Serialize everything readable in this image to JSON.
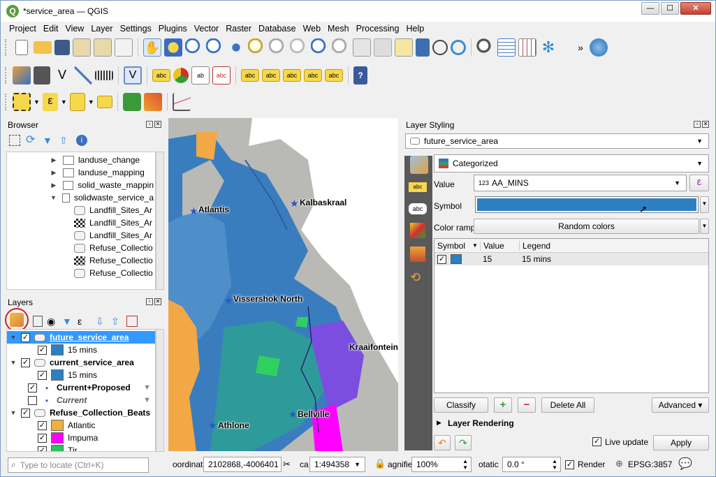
{
  "window": {
    "title": "*service_area — QGIS",
    "minimize": "—",
    "maximize": "☐",
    "close": "✕"
  },
  "menu": [
    "Project",
    "Edit",
    "View",
    "Layer",
    "Settings",
    "Plugins",
    "Vector",
    "Raster",
    "Database",
    "Web",
    "Mesh",
    "Processing",
    "Help"
  ],
  "browser": {
    "title": "Browser",
    "items": [
      {
        "label": "landuse_change",
        "type": "folder",
        "indent": 1,
        "arrow": "▶"
      },
      {
        "label": "landuse_mapping",
        "type": "folder",
        "indent": 1,
        "arrow": "▶"
      },
      {
        "label": "solid_waste_mappin",
        "type": "folder",
        "indent": 1,
        "arrow": "▶"
      },
      {
        "label": "solidwaste_service_a",
        "type": "folder",
        "indent": 1,
        "arrow": "▼"
      },
      {
        "label": "Landfill_Sites_Ar",
        "type": "polygon",
        "indent": 2
      },
      {
        "label": "Landfill_Sites_Ar",
        "type": "raster",
        "indent": 2
      },
      {
        "label": "Landfill_Sites_Ar",
        "type": "polygon",
        "indent": 2
      },
      {
        "label": "Refuse_Collectio",
        "type": "polygon",
        "indent": 2
      },
      {
        "label": "Refuse_Collectio",
        "type": "raster",
        "indent": 2
      },
      {
        "label": "Refuse_Collectio",
        "type": "polygon",
        "indent": 2
      }
    ]
  },
  "layers": {
    "title": "Layers",
    "items": [
      {
        "label": "future_service_area",
        "kind": "layer",
        "checked": true,
        "selected": true,
        "arrow": "▼"
      },
      {
        "label": "15 mins",
        "kind": "class",
        "checked": true,
        "color": "#2e7fc2"
      },
      {
        "label": "current_service_area",
        "kind": "layer",
        "checked": true,
        "arrow": "▼"
      },
      {
        "label": "15 mins",
        "kind": "class",
        "checked": true,
        "color": "#2e7fc2"
      },
      {
        "label": "Current+Proposed",
        "kind": "point",
        "checked": true
      },
      {
        "label": "Current",
        "kind": "point-italic",
        "checked": false
      },
      {
        "label": "Refuse_Collection_Beats",
        "kind": "layer",
        "checked": true,
        "arrow": "▼"
      },
      {
        "label": "Atlantic",
        "kind": "class",
        "checked": true,
        "color": "#f0b040"
      },
      {
        "label": "Impuma",
        "kind": "class",
        "checked": true,
        "color": "#ff00ff"
      },
      {
        "label": "Tir...",
        "kind": "class",
        "checked": true,
        "color": "#30c060"
      }
    ]
  },
  "map_labels": [
    "Atlantis",
    "Kalbaskraal",
    "Vissershok North",
    "Kraaifontein",
    "Bellville",
    "Athlone"
  ],
  "styling": {
    "title": "Layer Styling",
    "layer": "future_service_area",
    "renderer": "Categorized",
    "value_label": "Value",
    "value_prefix": "123",
    "value": "AA_MINS",
    "symbol_label": "Symbol",
    "symbol_color": "#2e7fc2",
    "ramp_label": "Color ramp",
    "ramp": "Random colors",
    "table_headers": [
      "Symbol",
      "Value",
      "Legend"
    ],
    "table_rows": [
      {
        "checked": true,
        "color": "#2e7fc2",
        "value": "15",
        "legend": "15 mins"
      }
    ],
    "classify": "Classify",
    "delete_all": "Delete All",
    "advanced": "Advanced",
    "layer_rendering": "Layer Rendering",
    "live_update": "Live update",
    "apply": "Apply"
  },
  "status": {
    "locate_placeholder": "Type to locate (Ctrl+K)",
    "coord_label": "oordinat",
    "coord": "2102868,-4006401",
    "scale_label": "ca",
    "scale": "1:494358",
    "magnifier_label": "agnifie",
    "magnifier": "100%",
    "rotation_label": "otatic",
    "rotation": "0.0 °",
    "render": "Render",
    "crs": "EPSG:3857"
  }
}
